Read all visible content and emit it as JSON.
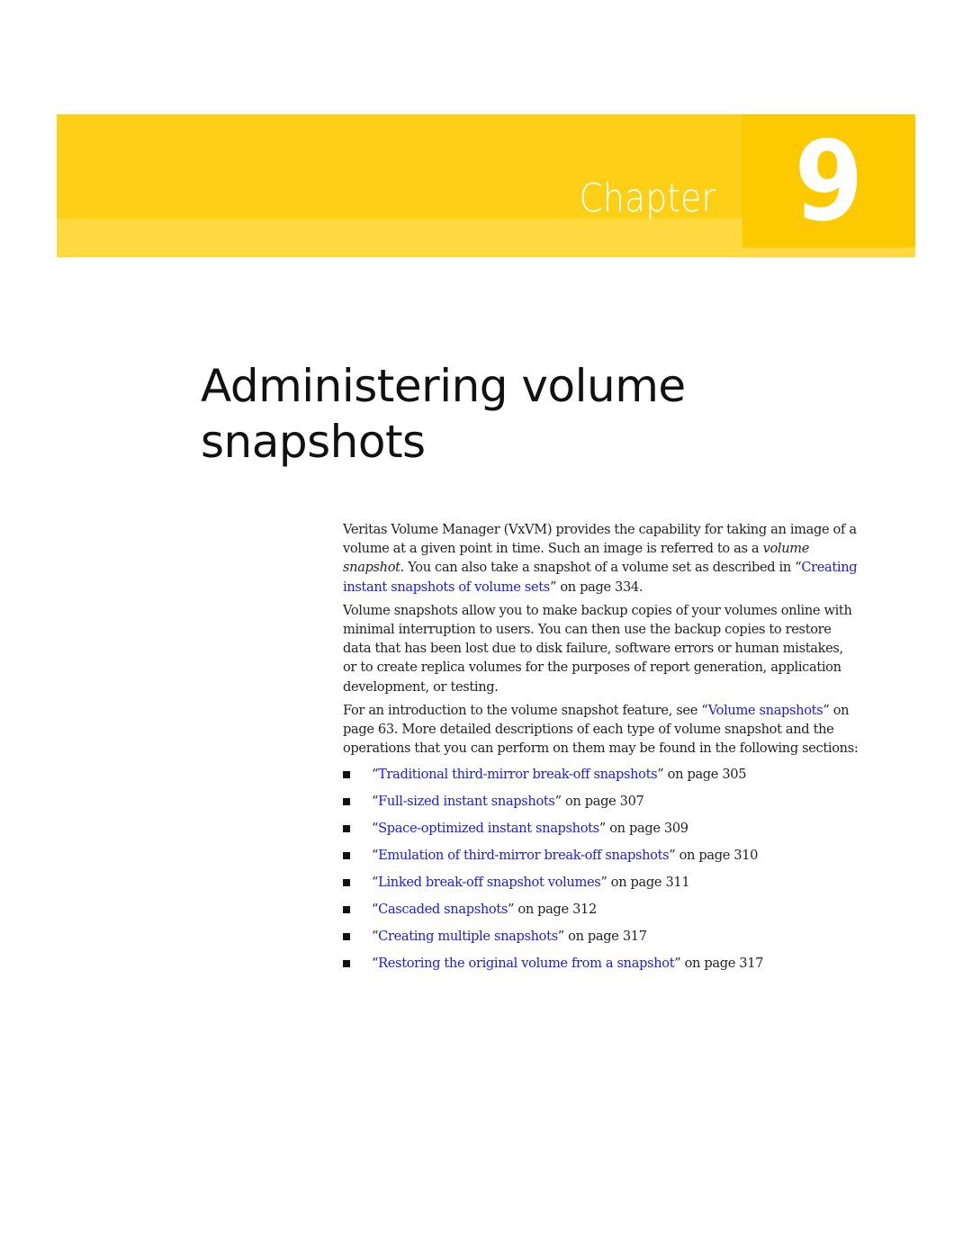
{
  "banner": {
    "chapter_label": "Chapter",
    "chapter_number": "9",
    "colors": {
      "main": "#fdd017",
      "lower_band": "#ffd940",
      "number_box": "#fdca00",
      "text": "#ffffff"
    }
  },
  "title": {
    "line1": "Administering volume",
    "line2": "snapshots"
  },
  "paragraphs": {
    "p1": {
      "t1": "Veritas Volume Manager (VxVM) provides the capability for taking an image of a volume at a given point in time. Such an image is referred to as a ",
      "em1": "volume snapshot",
      "t2": ". You can also take a snapshot of a volume set as described in “",
      "link": "Creating instant snapshots of volume sets",
      "t3": "” on page 334."
    },
    "p2": {
      "text": "Volume snapshots allow you to make backup copies of your volumes online with minimal interruption to users. You can then use the backup copies to restore data that has been lost due to disk failure, software errors or human mistakes, or to create replica volumes for the purposes of report generation, application development, or testing."
    },
    "p3": {
      "t1": "For an introduction to the volume snapshot feature, see “",
      "link": "Volume snapshots",
      "t2": "” on page 63. More detailed descriptions of each type of volume snapshot and the operations that you can perform on them may be found in the following sections:"
    }
  },
  "link_color": "#1a1aee",
  "sections": [
    {
      "open": "“",
      "link": "Traditional third-mirror break-off snapshots",
      "close": "” on page 305"
    },
    {
      "open": "“",
      "link": "Full-sized instant snapshots",
      "close": "” on page 307"
    },
    {
      "open": "“",
      "link": "Space-optimized instant snapshots",
      "close": "” on page 309"
    },
    {
      "open": "“",
      "link": "Emulation of third-mirror break-off snapshots",
      "close": "” on page 310"
    },
    {
      "open": "“",
      "link": "Linked break-off snapshot volumes",
      "close": "” on page 311"
    },
    {
      "open": "“",
      "link": "Cascaded snapshots",
      "close": "” on page 312"
    },
    {
      "open": "“",
      "link": "Creating multiple snapshots",
      "close": "” on page 317"
    },
    {
      "open": "“",
      "link": "Restoring the original volume from a snapshot",
      "close": "” on page 317"
    }
  ]
}
